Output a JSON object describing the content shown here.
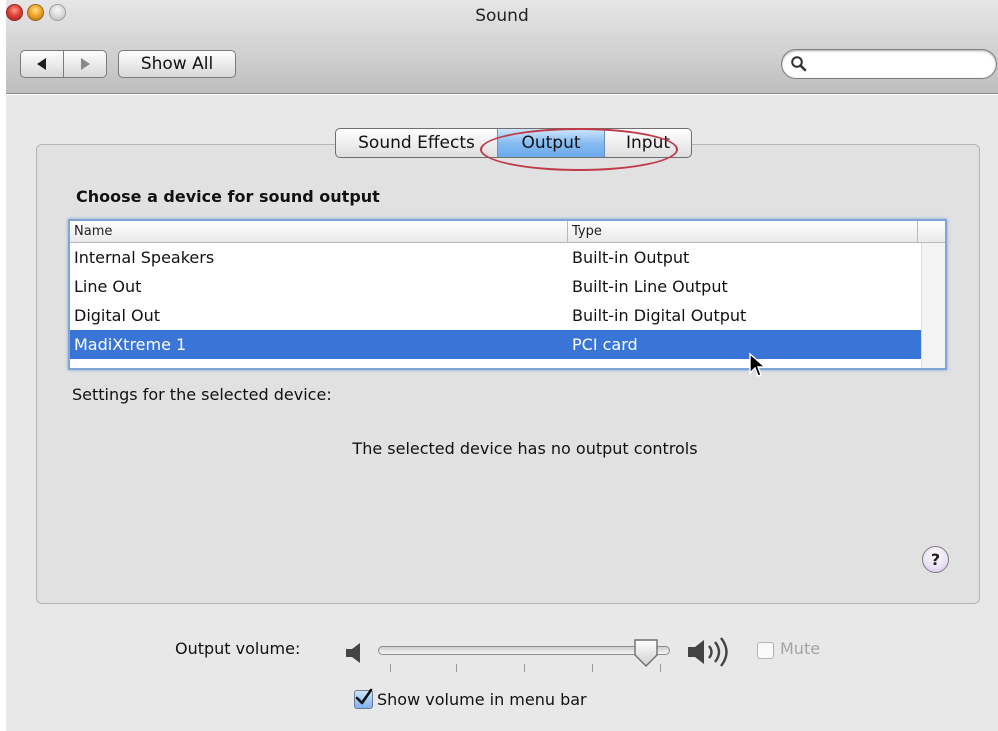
{
  "window": {
    "title": "Sound",
    "show_all_label": "Show All",
    "search_placeholder": ""
  },
  "tabs": [
    {
      "label": "Sound Effects",
      "selected": false
    },
    {
      "label": "Output",
      "selected": true
    },
    {
      "label": "Input",
      "selected": false
    }
  ],
  "output": {
    "section_title": "Choose a device for sound output",
    "columns": [
      "Name",
      "Type"
    ],
    "devices": [
      {
        "name": "Internal Speakers",
        "type": "Built-in Output",
        "selected": false
      },
      {
        "name": "Line Out",
        "type": "Built-in Line Output",
        "selected": false
      },
      {
        "name": "Digital Out",
        "type": "Built-in Digital Output",
        "selected": false
      },
      {
        "name": "MadiXtreme 1",
        "type": "PCI card",
        "selected": true
      }
    ],
    "settings_label": "Settings for the selected device:",
    "no_controls_text": "The selected device has no output controls",
    "help_label": "?"
  },
  "bottom": {
    "volume_label": "Output volume:",
    "volume_level_fraction": 0.95,
    "mute_label": "Mute",
    "mute_checked": false,
    "menu_bar_label": "Show volume in menu bar",
    "menu_bar_checked": true
  },
  "colors": {
    "selection": "#3875d7",
    "annotation_oval": "#c03a48",
    "tab_selected": "#87bcf2"
  },
  "icons": {
    "back": "left-triangle-icon",
    "forward": "right-triangle-icon",
    "search": "magnifier-icon",
    "volume_low": "speaker-low-icon",
    "volume_high": "speaker-high-icon",
    "checkmark": "checkmark-icon",
    "cursor": "arrow-cursor-icon",
    "help": "help-icon"
  }
}
